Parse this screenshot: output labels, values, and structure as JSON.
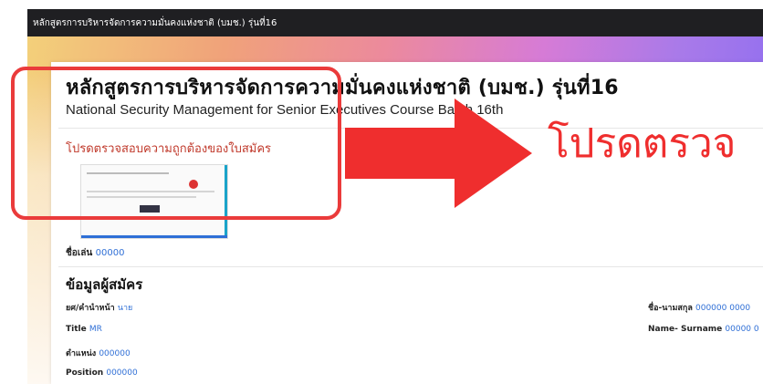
{
  "topbar": {
    "title": "หลักสูตรการบริหารจัดการความมั่นคงแห่งชาติ (บมช.) รุ่นที่16"
  },
  "header": {
    "title_th": "หลักสูตรการบริหารจัดการความมั่นคงแห่งชาติ (บมช.) รุ่นที่16",
    "title_en": "National Security Management for Senior Executives Course Batch 16th"
  },
  "review": {
    "link_text": "โปรดตรวจสอบความถูกต้องของใบสมัคร",
    "nickname_label": "ชื่อเล่น",
    "nickname_value": "00000"
  },
  "applicant": {
    "section_title": "ข้อมูลผู้สมัคร",
    "rank_label": "ยศ/คำนำหน้า",
    "rank_value": "นาย",
    "title_label": "Title",
    "title_value": "MR",
    "position_th_label": "ตำแหน่ง",
    "position_th_value": "000000",
    "position_en_label": "Position",
    "position_en_value": "000000",
    "name_th_label": "ชื่อ-นามสกุล",
    "name_th_value": "000000 0000",
    "name_en_label": "Name- Surname",
    "name_en_value": "00000 0"
  },
  "overlay": {
    "text": "โปรดตรวจ"
  },
  "colors": {
    "accent_red": "#ef2e2e",
    "link_blue": "#2f6fd6"
  },
  "icons": {
    "arrow": "arrow-right-icon"
  }
}
